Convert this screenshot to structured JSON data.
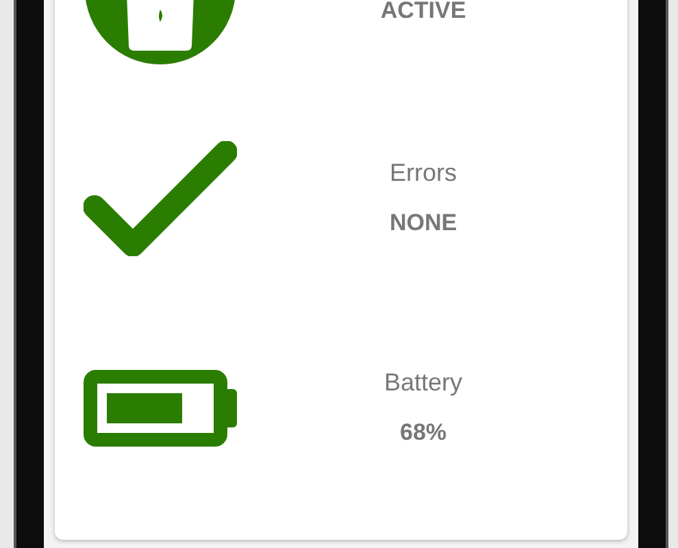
{
  "status_items": [
    {
      "kind": "device",
      "value": "ACTIVE"
    },
    {
      "kind": "check",
      "label": "Errors",
      "value": "NONE"
    },
    {
      "kind": "battery",
      "label": "Battery",
      "value": "68%"
    }
  ]
}
